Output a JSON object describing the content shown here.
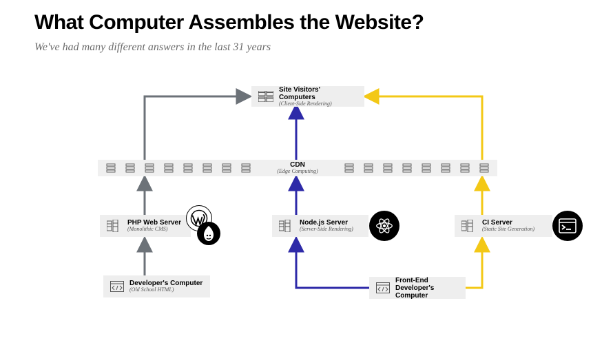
{
  "title": "What Computer Assembles the Website?",
  "subtitle": "We've had many different answers in the last 31 years",
  "colors": {
    "gray": "#6c7278",
    "blue": "#2e2aa8",
    "yellow": "#f3c816"
  },
  "cdn": {
    "label": "CDN",
    "sub": "(Edge Computing)"
  },
  "nodes": {
    "visitors": {
      "label": "Site Visitors' Computers",
      "sub": "(Client-Side Rendering)"
    },
    "php": {
      "label": "PHP Web Server",
      "sub": "(Monolithic CMS)"
    },
    "node": {
      "label": "Node.js Server",
      "sub": "(Server-Side Rendering)"
    },
    "ci": {
      "label": "CI Server",
      "sub": "(Static Site Generation)"
    },
    "dev": {
      "label": "Developer's Computer",
      "sub": "(Old School HTML)"
    },
    "fedev": {
      "label": "Front-End",
      "label2": "Developer's Computer"
    }
  },
  "badges": {
    "wordpress": "wordpress-icon",
    "drupal": "drupal-icon",
    "react": "react-icon",
    "terminal": "terminal-icon"
  }
}
